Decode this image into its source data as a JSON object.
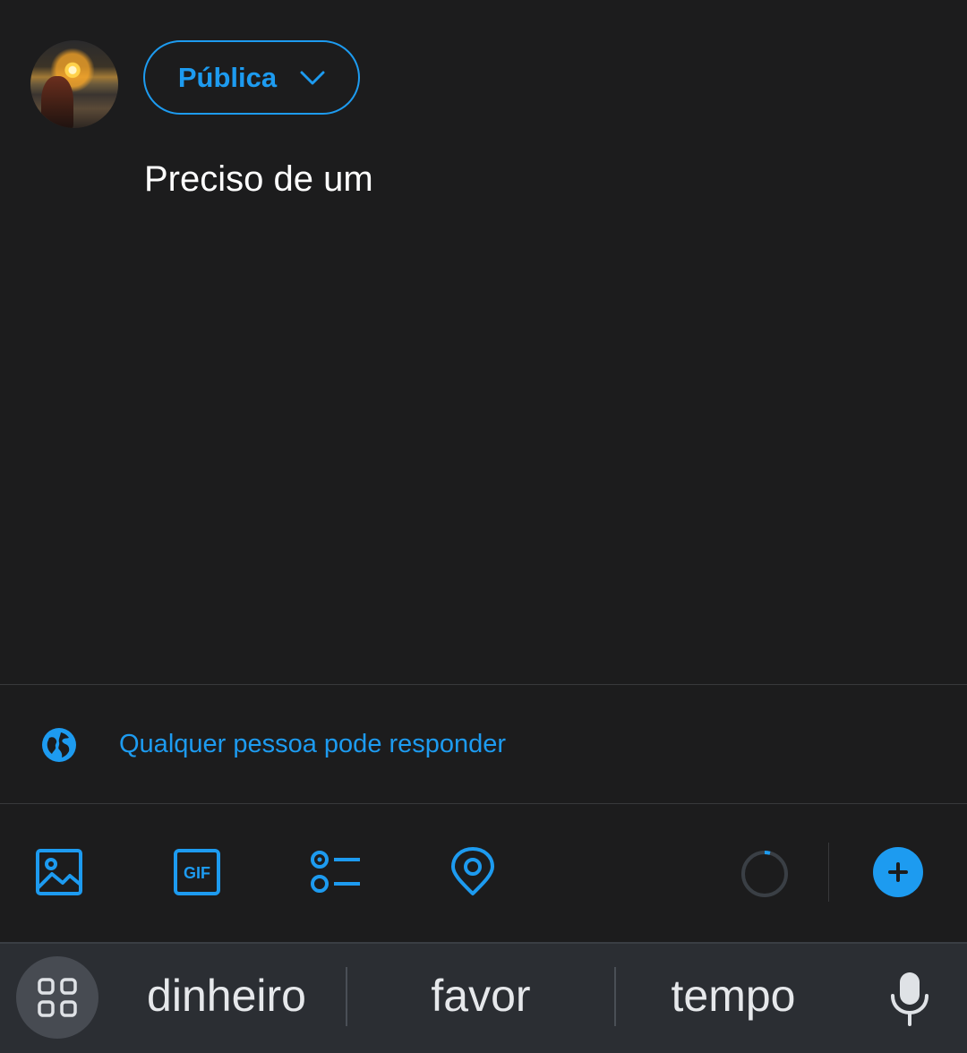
{
  "composer": {
    "audience_label": "Pública",
    "text": "Preciso de um",
    "reply_setting": "Qualquer pessoa pode responder"
  },
  "toolbar": {
    "icons": [
      "image-icon",
      "gif-icon",
      "poll-icon",
      "location-icon"
    ],
    "add_icon": "plus-icon"
  },
  "keyboard": {
    "suggestions": [
      "dinheiro",
      "favor",
      "tempo"
    ],
    "menu_icon": "grid-icon",
    "voice_icon": "microphone-icon"
  },
  "colors": {
    "accent": "#1d9bf0",
    "background": "#1c1c1d",
    "keyboard_bg": "#2b2e33"
  }
}
